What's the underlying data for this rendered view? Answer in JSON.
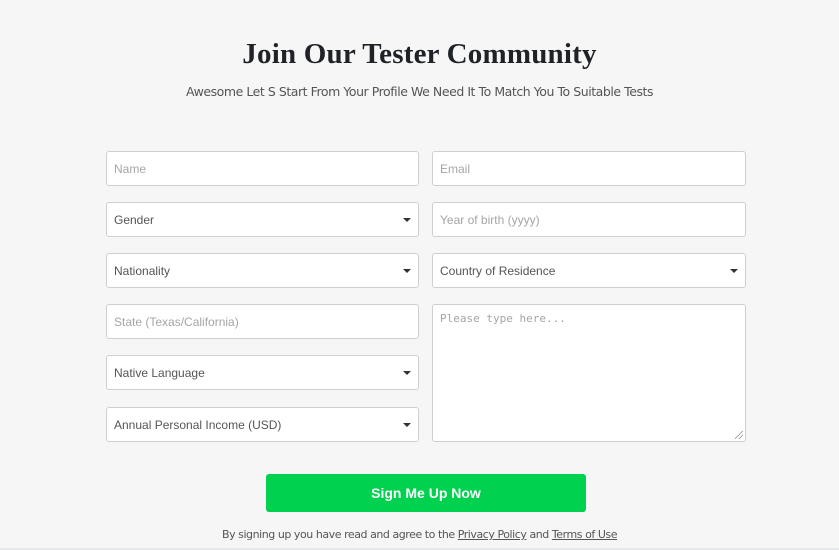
{
  "header": {
    "title": "Join Our Tester Community",
    "subtitle": "Awesome Let S Start From Your Profile We Need It To Match You To Suitable Tests"
  },
  "form": {
    "name": {
      "placeholder": "Name",
      "value": ""
    },
    "email": {
      "placeholder": "Email",
      "value": ""
    },
    "gender": {
      "selected": "Gender"
    },
    "year_of_birth": {
      "placeholder": "Year of birth (yyyy)",
      "value": ""
    },
    "nationality": {
      "selected": "Nationality"
    },
    "country_of_residence": {
      "selected": "Country of Residence"
    },
    "state": {
      "placeholder": "State (Texas/California)",
      "value": ""
    },
    "native_language": {
      "selected": "Native Language"
    },
    "annual_income": {
      "selected": "Annual Personal Income (USD)"
    },
    "comments": {
      "placeholder": "Please type here...",
      "value": ""
    }
  },
  "submit": {
    "label": "Sign Me Up Now",
    "color": "#00d14f"
  },
  "terms": {
    "prefix": "By signing up you have read and agree to the ",
    "privacy_link": "Privacy Policy",
    "conjunction": " and ",
    "terms_link": "Terms of Use"
  }
}
